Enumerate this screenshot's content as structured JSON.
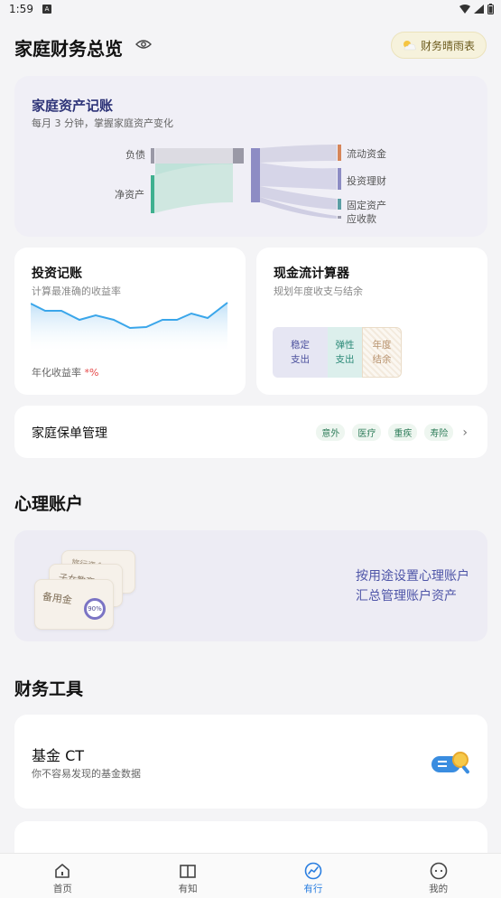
{
  "status_bar": {
    "time": "1:59",
    "notification_icon": "A"
  },
  "header": {
    "title": "家庭财务总览",
    "weather_button": "财务晴雨表"
  },
  "assets_card": {
    "title": "家庭资产记账",
    "subtitle": "每月 3 分钟，掌握家庭资产变化",
    "left_labels": [
      "负债",
      "净资产"
    ],
    "right_labels": [
      "流动资金",
      "投资理财",
      "固定资产",
      "应收款"
    ]
  },
  "invest_card": {
    "title": "投资记账",
    "subtitle": "计算最准确的收益率",
    "rate_label": "年化收益率",
    "rate_value": "*%"
  },
  "cash_card": {
    "title": "现金流计算器",
    "subtitle": "规划年度收支与结余",
    "blocks": [
      {
        "line1": "稳定",
        "line2": "支出"
      },
      {
        "line1": "弹性",
        "line2": "支出"
      },
      {
        "line1": "年度",
        "line2": "结余"
      }
    ]
  },
  "policy_card": {
    "label": "家庭保单管理",
    "tags": [
      "意外",
      "医疗",
      "重疾",
      "寿险"
    ]
  },
  "mental_section": {
    "title": "心理账户",
    "line1": "按用途设置心理账户",
    "line2": "汇总管理账户资产",
    "stack_labels": [
      "旅行资金",
      "子女教育",
      "备用金"
    ],
    "badge": "90%"
  },
  "tools_section": {
    "title": "财务工具",
    "fund_name": "基金 CT",
    "fund_desc": "你不容易发现的基金数据"
  },
  "tabbar": {
    "items": [
      {
        "label": "首页",
        "icon": "home-icon"
      },
      {
        "label": "有知",
        "icon": "book-icon"
      },
      {
        "label": "有行",
        "icon": "trend-icon"
      },
      {
        "label": "我的",
        "icon": "profile-icon"
      }
    ],
    "active": 2
  },
  "colors": {
    "accent": "#2a7ee0",
    "rate_red": "#e54848",
    "card_title_blue": "#2e3478"
  }
}
